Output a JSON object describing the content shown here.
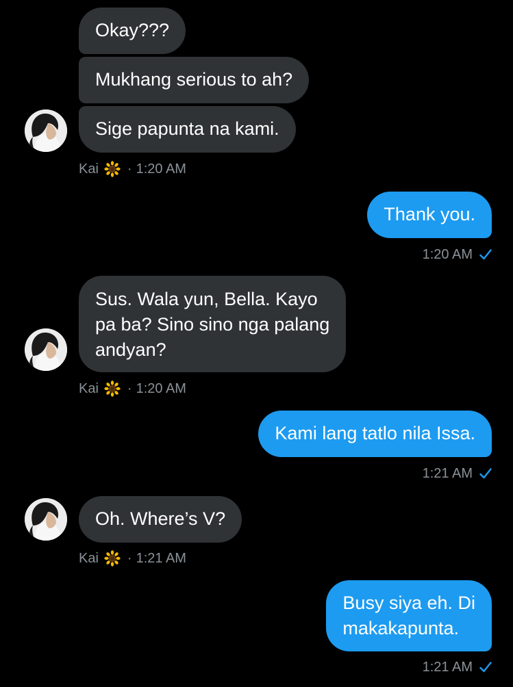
{
  "conversation": {
    "messages": [
      {
        "direction": "in",
        "text": "Okay???"
      },
      {
        "direction": "in",
        "text": "Mukhang serious to ah?"
      },
      {
        "direction": "in",
        "text": "Sige papunta na kami."
      },
      {
        "direction": "out",
        "text": "Thank you."
      },
      {
        "direction": "in",
        "lines": [
          "Sus. Wala yun, Bella. Kayo",
          "pa ba? Sino sino nga palang",
          "andyan?"
        ]
      },
      {
        "direction": "out",
        "text": "Kami lang tatlo nila Issa."
      },
      {
        "direction": "in",
        "text": "Oh. Where’s V?"
      },
      {
        "direction": "out",
        "lines": [
          "Busy siya eh. Di",
          "makakapunta."
        ]
      }
    ],
    "meta": [
      {
        "sender": "Kai",
        "emoji_icon": "sunflower-icon",
        "separator": "·",
        "time": "1:20 AM"
      },
      {
        "time": "1:20 AM",
        "status_icon": "checkmark-icon"
      },
      {
        "sender": "Kai",
        "emoji_icon": "sunflower-icon",
        "separator": "·",
        "time": "1:20 AM"
      },
      {
        "time": "1:21 AM",
        "status_icon": "checkmark-icon"
      },
      {
        "sender": "Kai",
        "emoji_icon": "sunflower-icon",
        "separator": "·",
        "time": "1:21 AM"
      },
      {
        "time": "1:21 AM",
        "status_icon": "checkmark-icon"
      }
    ]
  },
  "colors": {
    "background": "#000000",
    "incoming_bubble": "#2f3336",
    "outgoing_bubble": "#1d9bf0",
    "meta_text": "#8b9298",
    "check": "#1d9bf0"
  }
}
